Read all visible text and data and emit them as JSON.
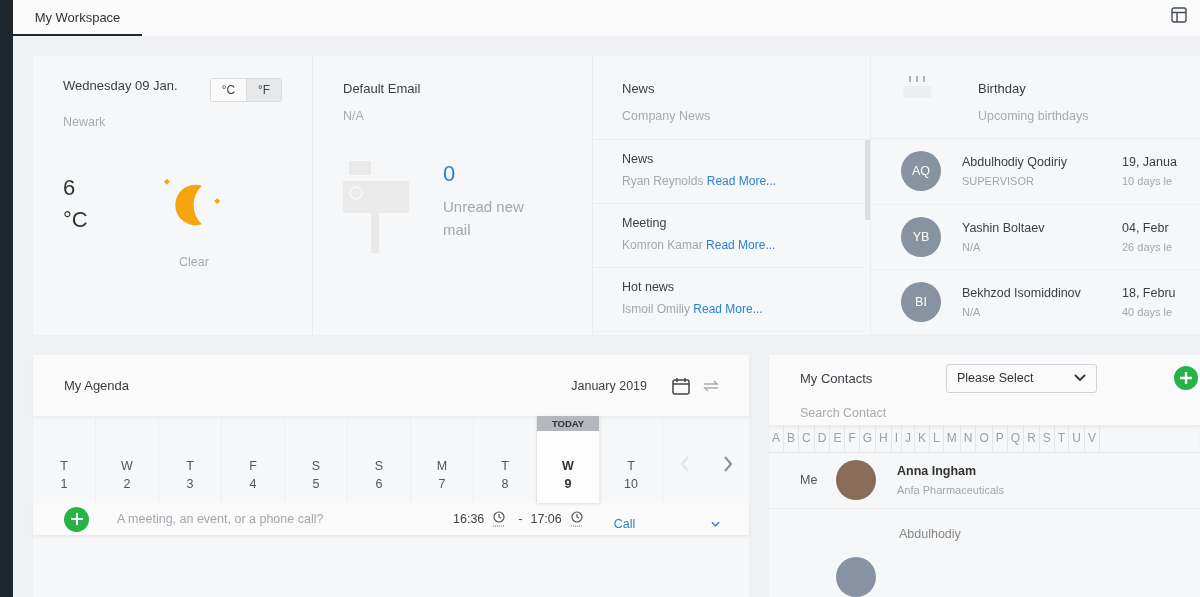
{
  "tabs": [
    {
      "label": "My Workspace",
      "selected": true
    }
  ],
  "weather": {
    "date": "Wednesday 09 Jan.",
    "units": [
      {
        "label": "°C",
        "selected": false
      },
      {
        "label": "°F",
        "selected": true
      }
    ],
    "city": "Newark",
    "temperature": "6",
    "unit": "°C",
    "condition": "Clear"
  },
  "email": {
    "title": "Default Email",
    "address": "N/A",
    "count": "0",
    "label": "Unread new mail"
  },
  "news": {
    "title": "News",
    "subtitle": "Company News",
    "items": [
      {
        "title": "News",
        "author": "Ryan Reynolds",
        "link": "Read More..."
      },
      {
        "title": "Meeting",
        "author": "Komron Kamar",
        "link": "Read More..."
      },
      {
        "title": "Hot news",
        "author": "Ismoil Omiliy",
        "link": "Read More..."
      }
    ]
  },
  "birthday": {
    "title": "Birthday",
    "subtitle": "Upcoming birthdays",
    "people": [
      {
        "initials": "AQ",
        "name": "Abdulhodiy Qodiriy",
        "role": "SUPERVISOR",
        "date": "19, Janua",
        "days_left": "10 days le"
      },
      {
        "initials": "YB",
        "name": "Yashin Boltaev",
        "role": "N/A",
        "date": "04, Febr",
        "days_left": "26 days le"
      },
      {
        "initials": "BI",
        "name": "Bekhzod Isomiddinov",
        "role": "N/A",
        "date": "18, Febru",
        "days_left": "40 days le"
      }
    ]
  },
  "agenda": {
    "title": "My Agenda",
    "month": "January 2019",
    "today_label": "TODAY",
    "days": [
      {
        "weekday": "T",
        "day": "1",
        "selected": false
      },
      {
        "weekday": "W",
        "day": "2",
        "selected": false
      },
      {
        "weekday": "T",
        "day": "3",
        "selected": false
      },
      {
        "weekday": "F",
        "day": "4",
        "selected": false
      },
      {
        "weekday": "S",
        "day": "5",
        "selected": false
      },
      {
        "weekday": "S",
        "day": "6",
        "selected": false
      },
      {
        "weekday": "M",
        "day": "7",
        "selected": false
      },
      {
        "weekday": "T",
        "day": "8",
        "selected": false
      },
      {
        "weekday": "W",
        "day": "9",
        "selected": true
      },
      {
        "weekday": "T",
        "day": "10",
        "selected": false
      }
    ],
    "prev_disabled": true,
    "event": {
      "placeholder": "A meeting, an event, or a phone call?",
      "start": "16:36",
      "separator": "-",
      "end": "17:06",
      "type": "Call"
    }
  },
  "contacts": {
    "title": "My Contacts",
    "filter": "Please Select",
    "search_placeholder": "Search Contact",
    "letters": [
      "A",
      "B",
      "C",
      "D",
      "E",
      "F",
      "G",
      "H",
      "I",
      "J",
      "K",
      "L",
      "M",
      "N",
      "O",
      "P",
      "Q",
      "R",
      "S",
      "T",
      "U",
      "V"
    ],
    "people": [
      {
        "kind": "me",
        "label": "Me",
        "name": "Anna Ingham",
        "company": "Anfa Pharmaceuticals"
      },
      {
        "kind": "other",
        "name": "Abdulhodiy"
      }
    ]
  }
}
